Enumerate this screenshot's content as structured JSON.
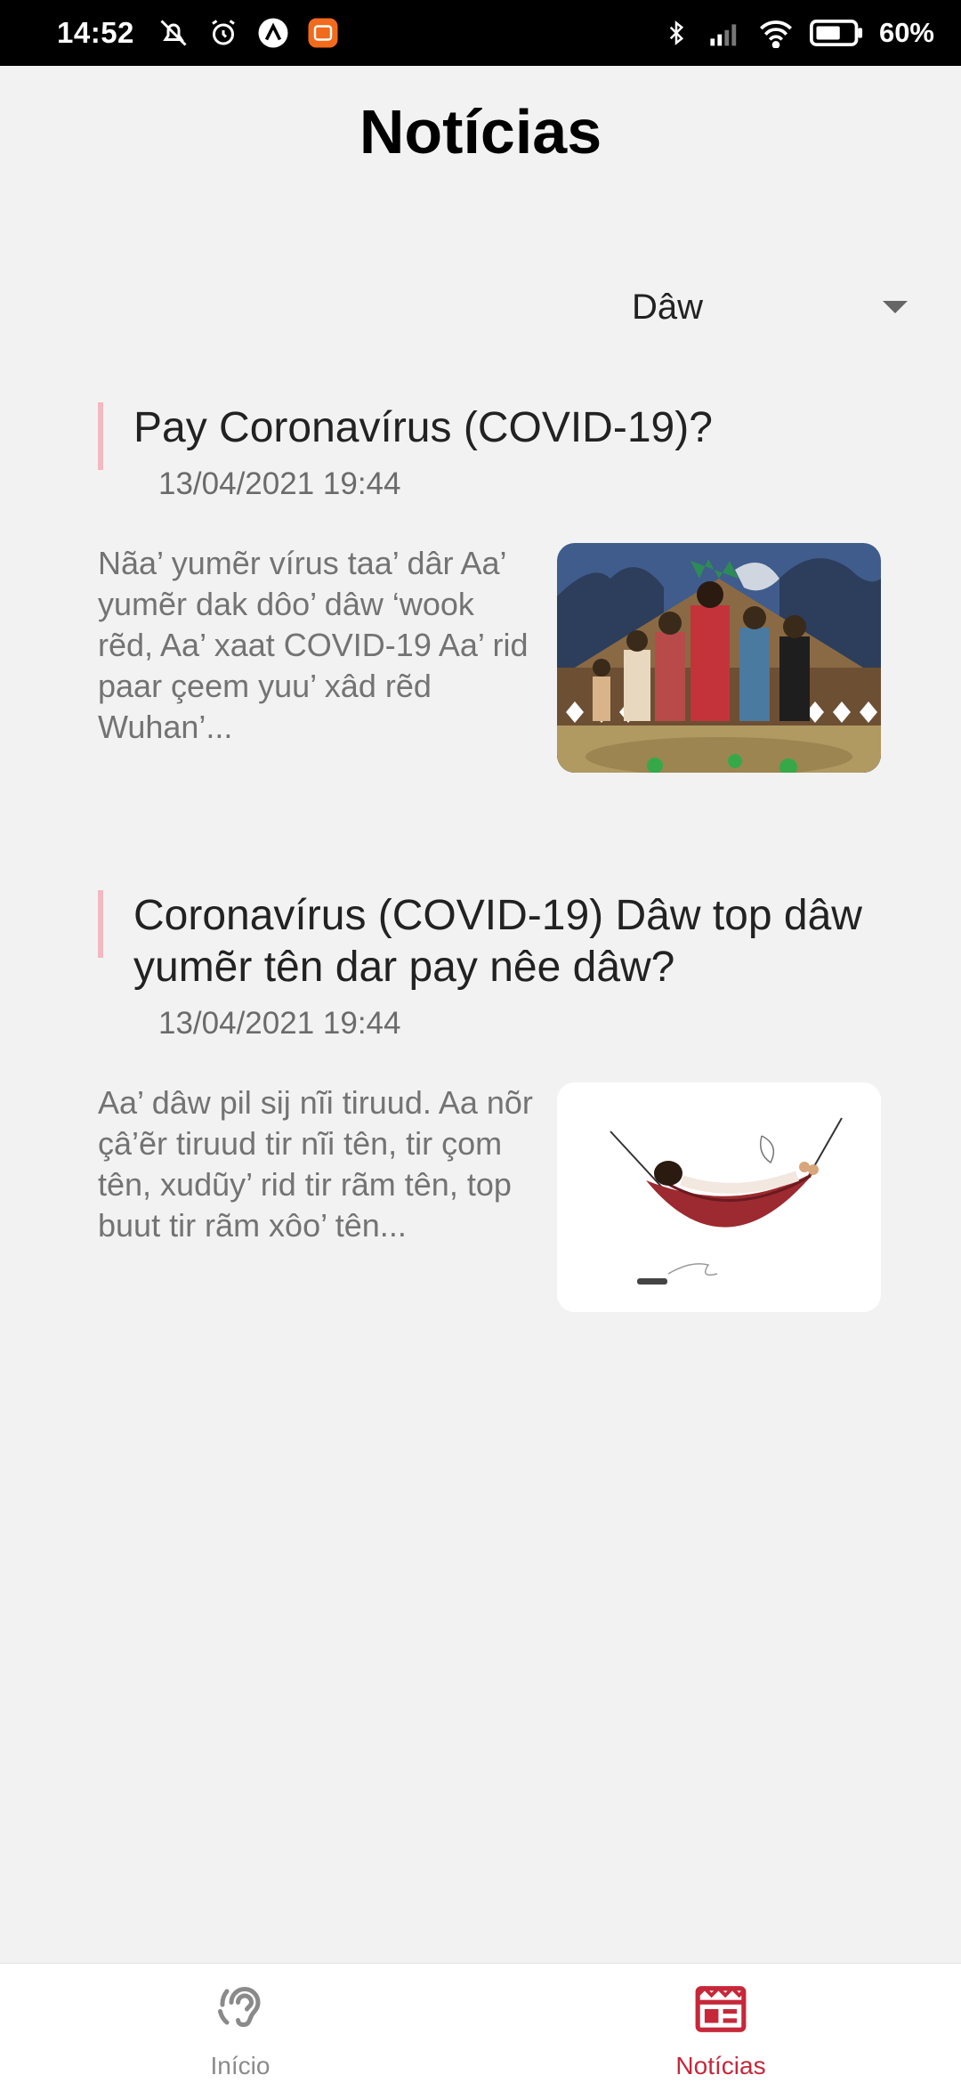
{
  "status_bar": {
    "time": "14:52",
    "battery": "60%"
  },
  "page": {
    "title": "Notícias"
  },
  "language_select": {
    "value": "Dâw"
  },
  "news": [
    {
      "title": "Pay Coronavírus (COVID-19)?",
      "date": "13/04/2021 19:44",
      "excerpt": "Nãa’ yumẽr vírus taa’ dâr Aa’ yumẽr dak dôo’ dâw ‘wook rẽd, Aa’ xaat COVID-19 Aa’ rid paar çeem yuu’ xâd rẽd Wuhan’...",
      "image_icon": "illustration-group-people"
    },
    {
      "title": "Coronavírus (COVID-19) Dâw top dâw yumẽr tên dar pay nêe dâw?",
      "date": "13/04/2021 19:44",
      "excerpt": " Aa’ dâw pil sij nĩi tiruud. Aa nõr çâ’ẽr tiruud tir nĩi tên, tir çom tên, xudũy’ rid tir rãm tên, top buut tir rãm xôo’ tên...",
      "image_icon": "illustration-person-hammock"
    }
  ],
  "bottom_nav": {
    "items": [
      {
        "label": "Início",
        "icon": "ear-icon",
        "active": false
      },
      {
        "label": "Notícias",
        "icon": "newspaper-icon",
        "active": true
      }
    ]
  },
  "colors": {
    "accent": "#c62839",
    "accent_bar": "#f3b9c0",
    "background": "#f2f2f2"
  }
}
